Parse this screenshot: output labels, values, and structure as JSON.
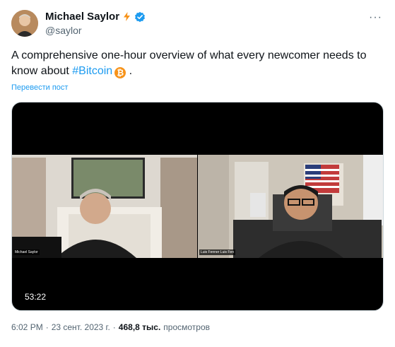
{
  "author": {
    "name": "Michael Saylor",
    "handle": "@saylor",
    "badge_icon": "zap-icon",
    "verified_icon": "verified-icon"
  },
  "tweet": {
    "text_before": "A comprehensive one-hour overview of what every newcomer needs to know about ",
    "hashtag": "#Bitcoin",
    "btc_symbol": "₿",
    "text_after": " .",
    "translate_label": "Перевести пост"
  },
  "media": {
    "duration": "53:22",
    "left_label": "Michael Saylor",
    "right_label": "Luis Fenner Luis Fen"
  },
  "meta": {
    "time": "6:02 PM",
    "separator": "·",
    "date": "23 сент. 2023 г.",
    "separator2": "·",
    "views_count": "468,8 тыс.",
    "views_label": "просмотров"
  },
  "colors": {
    "accent": "#1d9bf0",
    "text": "#0f1419",
    "muted": "#536471",
    "bitcoin": "#f7931a"
  }
}
